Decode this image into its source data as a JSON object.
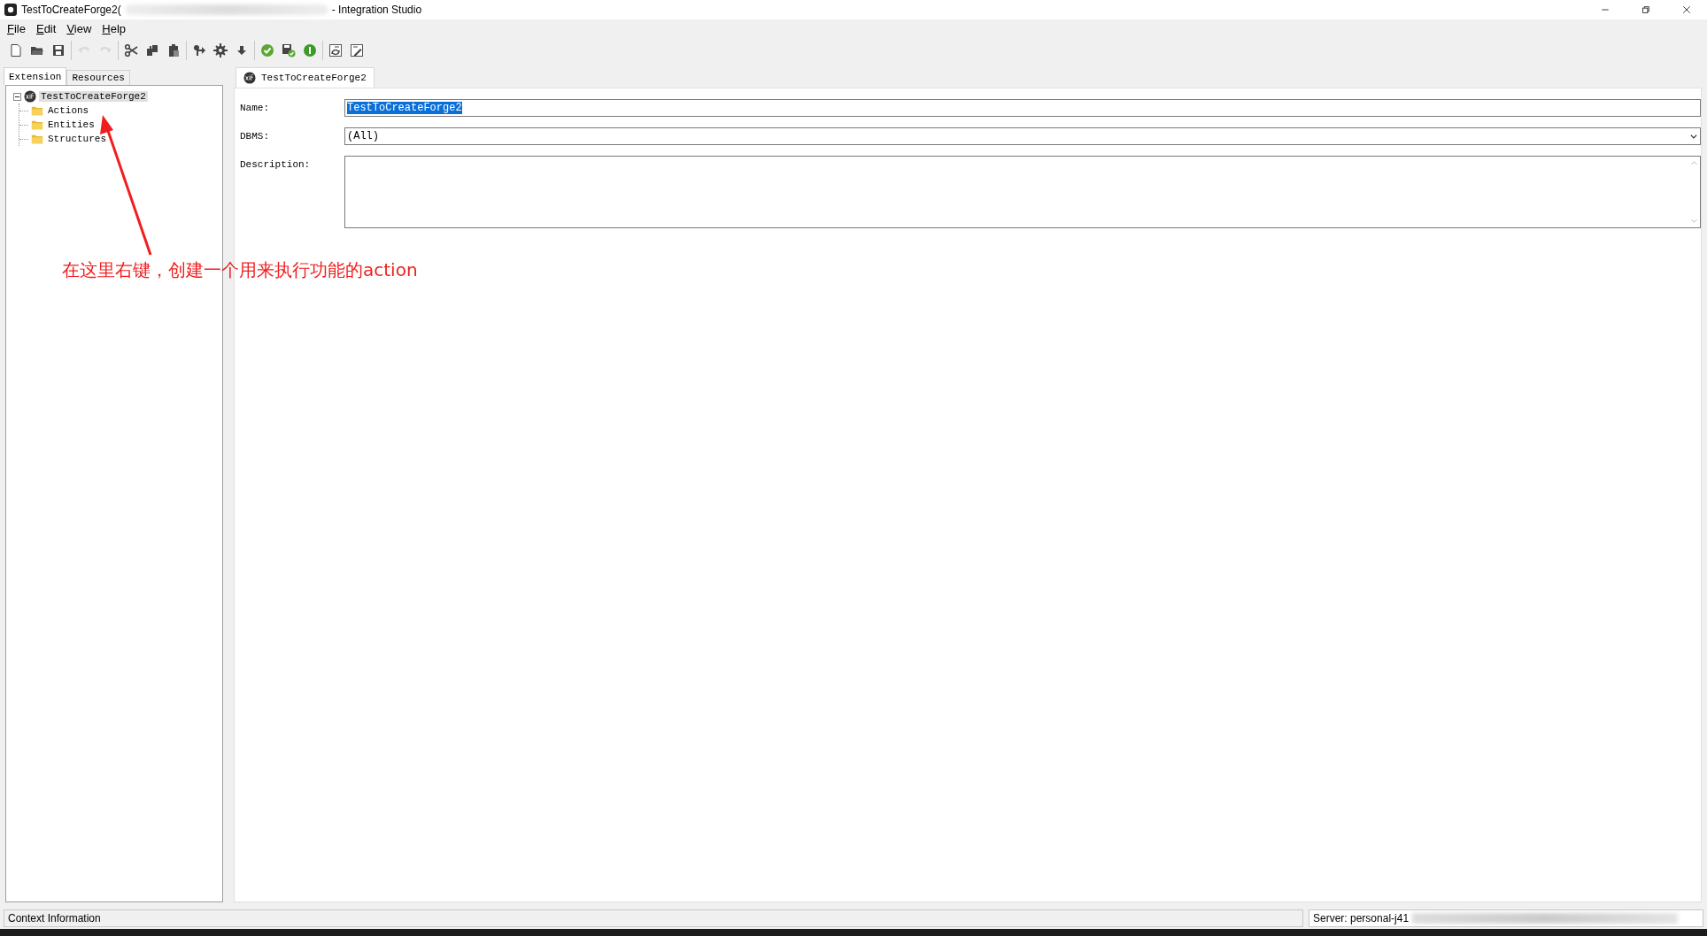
{
  "window": {
    "title": "TestToCreateForge2(",
    "title_suffix": "- Integration Studio"
  },
  "menu": [
    "File",
    "Edit",
    "View",
    "Help"
  ],
  "toolbar": [
    [
      {
        "kind": "new",
        "disabled": false
      },
      {
        "kind": "open",
        "disabled": false
      },
      {
        "kind": "save",
        "disabled": false
      }
    ],
    [
      {
        "kind": "undo",
        "disabled": true
      },
      {
        "kind": "redo",
        "disabled": true
      }
    ],
    [
      {
        "kind": "cut",
        "disabled": false
      },
      {
        "kind": "copy",
        "disabled": false
      },
      {
        "kind": "paste",
        "disabled": false
      }
    ],
    [
      {
        "kind": "publish",
        "disabled": false
      },
      {
        "kind": "gear",
        "disabled": false
      },
      {
        "kind": "down",
        "disabled": false
      }
    ],
    [
      {
        "kind": "verify",
        "disabled": false
      },
      {
        "kind": "savecheck",
        "disabled": false
      },
      {
        "kind": "info",
        "disabled": false
      }
    ],
    [
      {
        "kind": "csrefresh",
        "disabled": false
      },
      {
        "kind": "csedit",
        "disabled": false
      }
    ]
  ],
  "left_tabs": [
    {
      "label": "Extension",
      "selected": true
    },
    {
      "label": "Resources",
      "selected": false
    }
  ],
  "tree": [
    {
      "label": "TestToCreateForge2",
      "kind": "extension",
      "expanded": true,
      "selected": true,
      "children": [
        {
          "label": "Actions",
          "kind": "folder",
          "selected": false
        },
        {
          "label": "Entities",
          "kind": "folder",
          "selected": false
        },
        {
          "label": "Structures",
          "kind": "folder",
          "selected": false
        }
      ]
    }
  ],
  "editor_tabs": [
    {
      "label": "TestToCreateForge2",
      "selected": true
    }
  ],
  "form": {
    "name_label": "Name:",
    "name_value": "TestToCreateForge2",
    "dbms_label": "DBMS:",
    "dbms_value": "(All)",
    "description_label": "Description:"
  },
  "annotation": "在这里右键，创建一个用来执行功能的action",
  "status_bar": {
    "context": "Context Information",
    "server": "Server: personal-j41"
  }
}
